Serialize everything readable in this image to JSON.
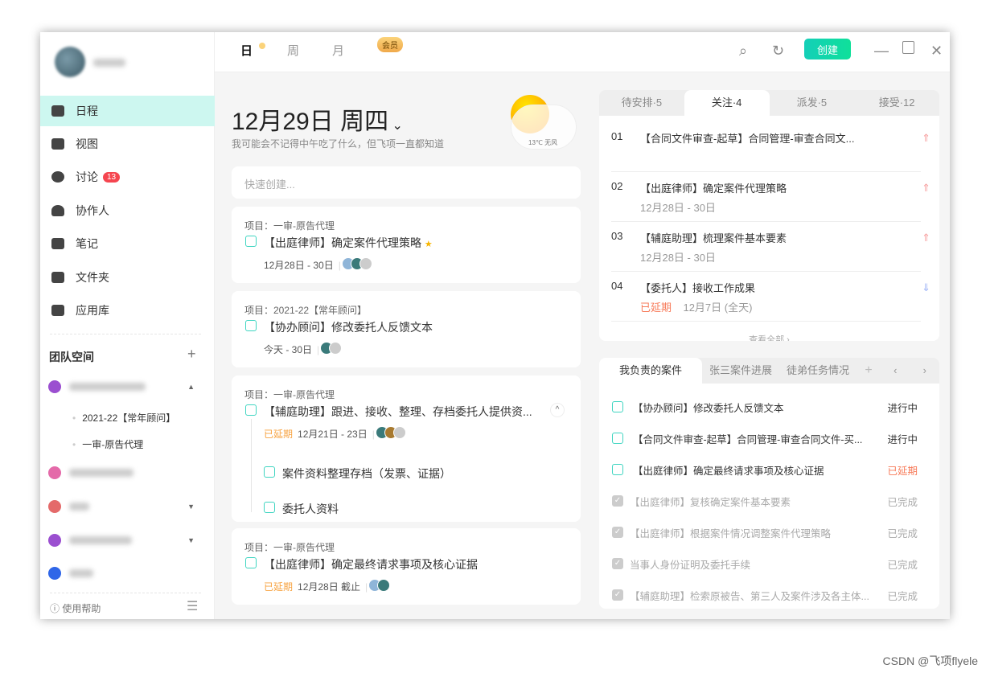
{
  "nav": [
    {
      "label": "日程"
    },
    {
      "label": "视图"
    },
    {
      "label": "讨论",
      "badge": "13"
    },
    {
      "label": "协作人"
    },
    {
      "label": "笔记"
    },
    {
      "label": "文件夹"
    },
    {
      "label": "应用库"
    }
  ],
  "team": {
    "title": "团队空间",
    "add": "+",
    "subprojects": [
      "2021-22【常年顾问】",
      "一审-原告代理"
    ],
    "help": "使用帮助"
  },
  "topbar": {
    "day": "日",
    "week": "周",
    "month": "月",
    "vip": "会员",
    "create": "创建"
  },
  "header": {
    "date": "12月29日 周四",
    "subtitle": "我可能会不记得中午吃了什么，但飞项一直都知道",
    "weather": "13℃ 无风"
  },
  "quick": {
    "placeholder": "快速创建..."
  },
  "tasks": [
    {
      "project": "项目：一审-原告代理",
      "title": "【出庭律师】确定案件代理策略",
      "date": "12月28日 - 30日"
    },
    {
      "project": "项目：2021-22【常年顾问】",
      "title": "【协办顾问】修改委托人反馈文本",
      "date": "今天 - 30日"
    },
    {
      "project": "项目：一审-原告代理",
      "title": "【辅庭助理】跟进、接收、整理、存档委托人提供资...",
      "late": "已延期",
      "date": "12月21日 - 23日",
      "subtasks": [
        "案件资料整理存档（发票、证据）",
        "委托人资料"
      ]
    },
    {
      "project": "项目：一审-原告代理",
      "title": "【出庭律师】确定最终请求事项及核心证据",
      "late": "已延期",
      "date": "12月28日 截止"
    }
  ],
  "follow": {
    "tabs": [
      "待安排·5",
      "关注·4",
      "派发·5",
      "接受·12"
    ],
    "items": [
      {
        "num": "01",
        "title": "【合同文件审查-起草】合同管理-审查合同文...",
        "date": ""
      },
      {
        "num": "02",
        "title": "【出庭律师】确定案件代理策略",
        "date": "12月28日 - 30日"
      },
      {
        "num": "03",
        "title": "【辅庭助理】梳理案件基本要素",
        "date": "12月28日 - 30日"
      },
      {
        "num": "04",
        "title": "【委托人】接收工作成果",
        "late": "已延期",
        "date": "12月7日 (全天)"
      }
    ],
    "more": "查看全部 ›"
  },
  "cases": {
    "tabs": [
      "我负责的案件",
      "张三案件进展",
      "徒弟任务情况"
    ],
    "items": [
      {
        "title": "【协办顾问】修改委托人反馈文本",
        "status": "进行中"
      },
      {
        "title": "【合同文件审查-起草】合同管理-审查合同文件-买...",
        "status": "进行中"
      },
      {
        "title": "【出庭律师】确定最终请求事项及核心证据",
        "status": "已延期"
      },
      {
        "title": "【出庭律师】复核确定案件基本要素",
        "status": "已完成"
      },
      {
        "title": "【出庭律师】根据案件情况调整案件代理策略",
        "status": "已完成"
      },
      {
        "title": "当事人身份证明及委托手续",
        "status": "已完成"
      },
      {
        "title": "【辅庭助理】检索原被告、第三人及案件涉及各主体...",
        "status": "已完成"
      }
    ]
  },
  "watermark": "CSDN @飞项flyele"
}
